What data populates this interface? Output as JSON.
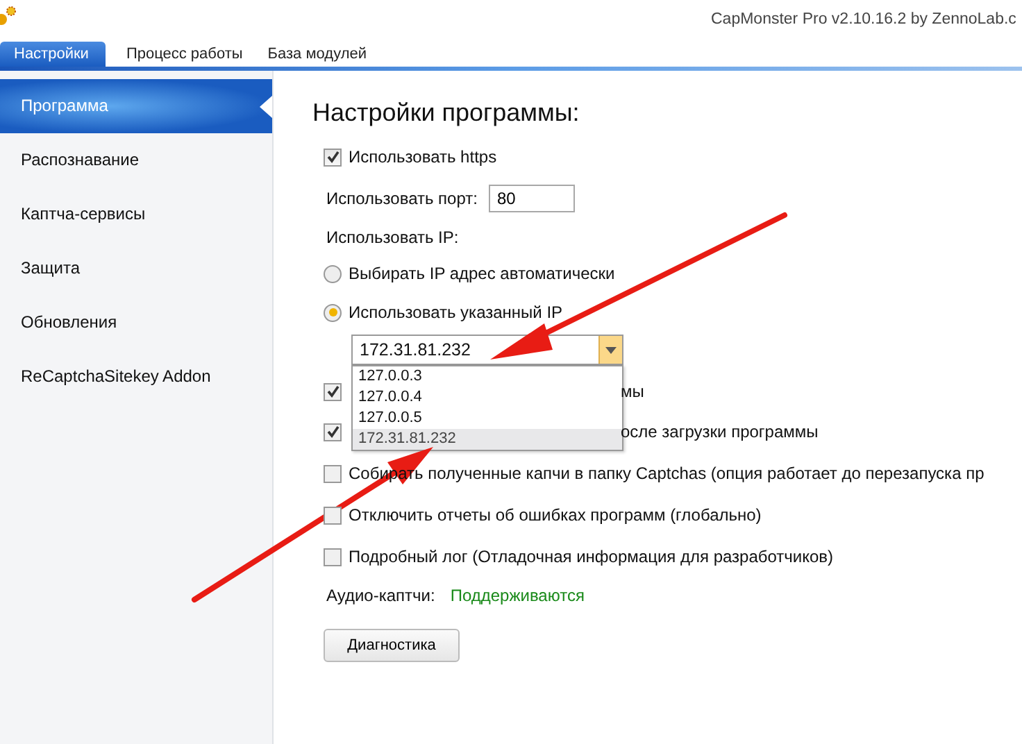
{
  "window": {
    "title": "CapMonster Pro v2.10.16.2 by ZennoLab.c"
  },
  "tabs": [
    {
      "label": "Настройки",
      "selected": true
    },
    {
      "label": "Процесс работы",
      "selected": false
    },
    {
      "label": "База модулей",
      "selected": false
    }
  ],
  "sidebar": {
    "items": [
      {
        "label": "Программа",
        "selected": true
      },
      {
        "label": "Распознавание",
        "selected": false
      },
      {
        "label": "Каптча-сервисы",
        "selected": false
      },
      {
        "label": "Защита",
        "selected": false
      },
      {
        "label": "Обновления",
        "selected": false
      },
      {
        "label": "ReCaptchaSitekey Addon",
        "selected": false
      }
    ]
  },
  "heading": "Настройки программы:",
  "https": {
    "label": "Использовать https",
    "checked": true
  },
  "port": {
    "label": "Использовать порт:",
    "value": "80"
  },
  "ip_label": "Использовать IP:",
  "ip_modes": [
    {
      "label": "Выбирать IP адрес автоматически",
      "selected": false
    },
    {
      "label": "Использовать указанный IP",
      "selected": true
    }
  ],
  "ip_combo": {
    "value": "172.31.81.232",
    "expanded": true,
    "options": [
      {
        "label": "127.0.0.3",
        "selected": false
      },
      {
        "label": "127.0.0.4",
        "selected": false
      },
      {
        "label": "127.0.0.5",
        "selected": false
      },
      {
        "label": "172.31.81.232",
        "selected": true
      }
    ]
  },
  "checkboxes": [
    {
      "label": "мы",
      "checked": true
    },
    {
      "label": "осле загрузки программы",
      "checked": true
    },
    {
      "label": "Собирать полученные капчи в папку Captchas (опция работает до перезапуска пр",
      "checked": false
    },
    {
      "label": "Отключить отчеты об ошибках программ (глобально)",
      "checked": false
    },
    {
      "label": "Подробный лог (Отладочная информация для разработчиков)",
      "checked": false
    }
  ],
  "audio": {
    "label": "Аудио-каптчи:",
    "status": "Поддерживаются"
  },
  "diagnostics_button": "Диагностика"
}
